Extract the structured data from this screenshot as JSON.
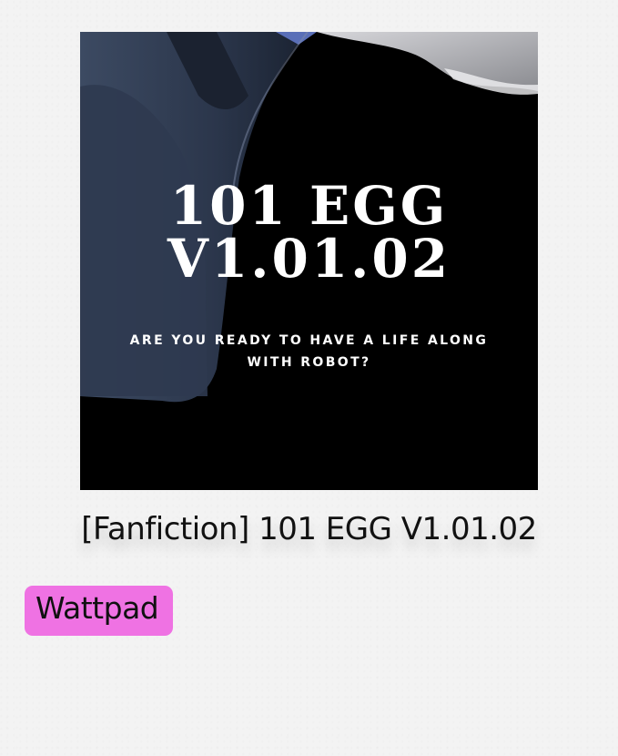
{
  "cover": {
    "title_line1": "101 EGG",
    "title_line2": "V1.01.02",
    "tagline": "ARE YOU READY TO HAVE A LIFE ALONG WITH ROBOT?"
  },
  "story": {
    "title": "[Fanfiction] 101 EGG V1.01.02"
  },
  "source_badge": {
    "label": "Wattpad",
    "color": "#ef72e3"
  }
}
